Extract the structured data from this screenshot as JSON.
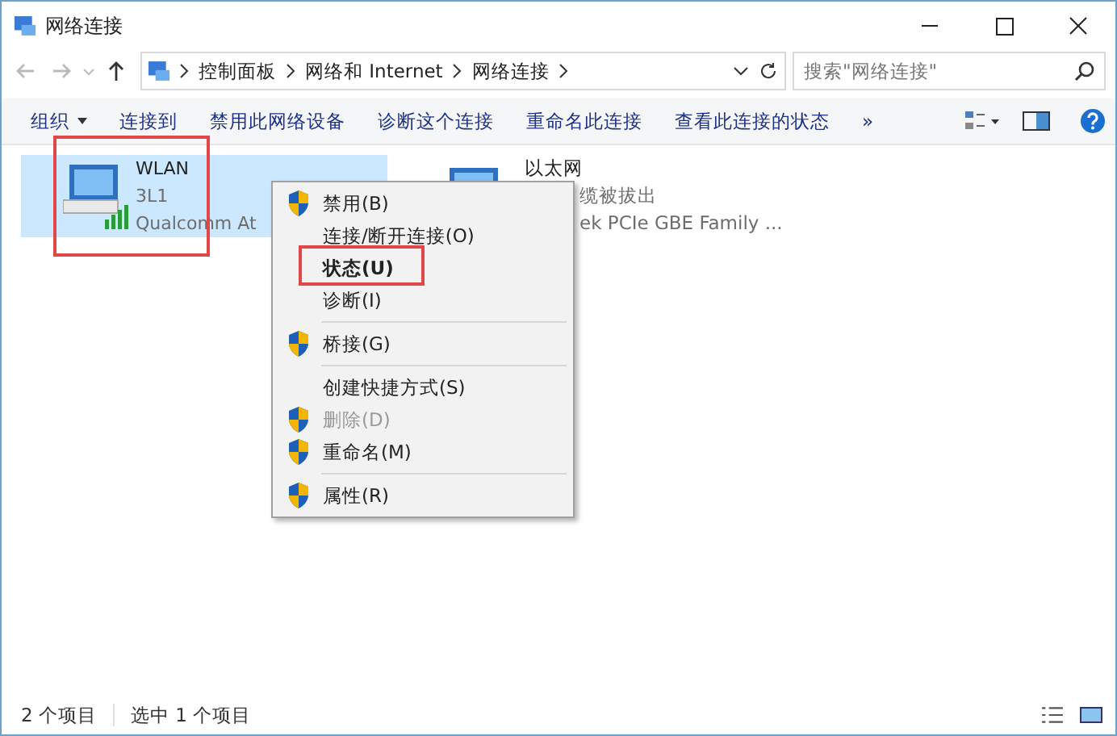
{
  "window": {
    "title": "网络连接"
  },
  "address": {
    "crumbs": [
      "控制面板",
      "网络和 Internet",
      "网络连接"
    ],
    "search_placeholder": "搜索\"网络连接\""
  },
  "toolbar": {
    "items": [
      {
        "label": "组织",
        "dropdown": true
      },
      {
        "label": "连接到",
        "dropdown": false
      },
      {
        "label": "禁用此网络设备",
        "dropdown": false
      },
      {
        "label": "诊断这个连接",
        "dropdown": false
      },
      {
        "label": "重命名此连接",
        "dropdown": false
      },
      {
        "label": "查看此连接的状态",
        "dropdown": false
      }
    ],
    "more": "»"
  },
  "connections": [
    {
      "kind": "wifi",
      "name": "WLAN",
      "status": "3L1",
      "device": "Qualcomm At",
      "selected": true,
      "highlight": true
    },
    {
      "kind": "ethernet",
      "name": "以太网",
      "status": "缆被拔出",
      "device": "ek PCIe GBE Family ...",
      "selected": false,
      "highlight": false
    }
  ],
  "context_menu": [
    {
      "kind": "shield",
      "label": "禁用(B)",
      "bold": false,
      "disabled": false,
      "highlight": false
    },
    {
      "kind": "plain",
      "label": "连接/断开连接(O)",
      "bold": false,
      "disabled": false,
      "highlight": false
    },
    {
      "kind": "plain",
      "label": "状态(U)",
      "bold": true,
      "disabled": false,
      "highlight": true
    },
    {
      "kind": "plain",
      "label": "诊断(I)",
      "bold": false,
      "disabled": false,
      "highlight": false
    },
    {
      "kind": "separator"
    },
    {
      "kind": "shield",
      "label": "桥接(G)",
      "bold": false,
      "disabled": false,
      "highlight": false
    },
    {
      "kind": "separator"
    },
    {
      "kind": "plain",
      "label": "创建快捷方式(S)",
      "bold": false,
      "disabled": false,
      "highlight": false
    },
    {
      "kind": "shield",
      "label": "删除(D)",
      "bold": false,
      "disabled": true,
      "highlight": false
    },
    {
      "kind": "shield",
      "label": "重命名(M)",
      "bold": false,
      "disabled": false,
      "highlight": false
    },
    {
      "kind": "separator"
    },
    {
      "kind": "shield",
      "label": "属性(R)",
      "bold": false,
      "disabled": false,
      "highlight": false
    }
  ],
  "status_bar": {
    "items": "2 个项目",
    "selection": "选中 1 个项目"
  }
}
